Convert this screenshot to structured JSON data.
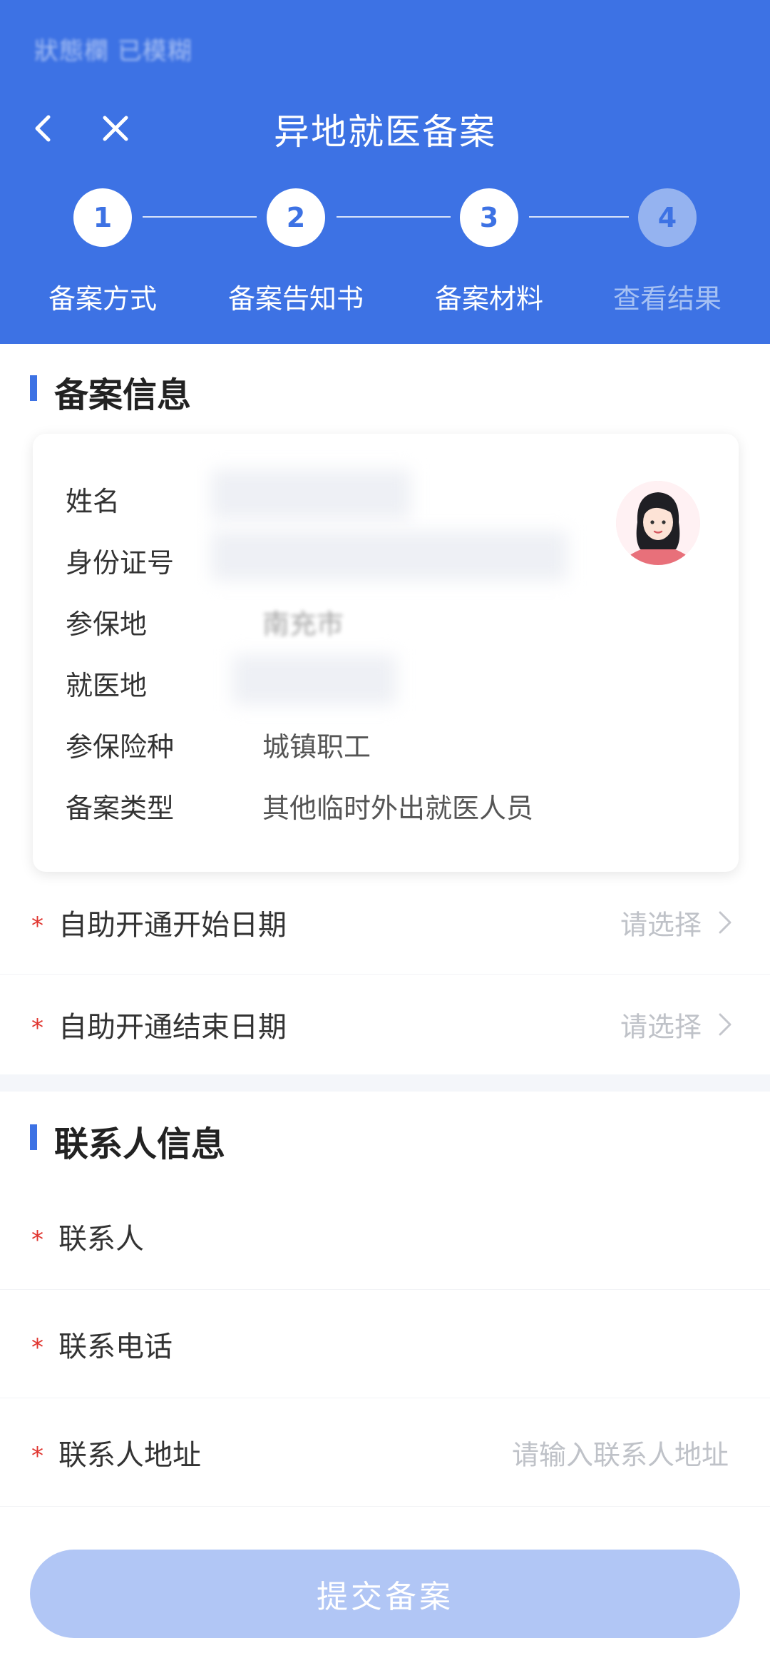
{
  "header": {
    "status_text": "狀態欄 已模糊",
    "title": "异地就医备案",
    "back_icon": "chevron-left-icon",
    "close_icon": "close-icon",
    "color": "#3d72e4"
  },
  "steps": [
    {
      "number": "1",
      "label": "备案方式",
      "state": "done"
    },
    {
      "number": "2",
      "label": "备案告知书",
      "state": "done"
    },
    {
      "number": "3",
      "label": "备案材料",
      "state": "current"
    },
    {
      "number": "4",
      "label": "查看结果",
      "state": "pending"
    }
  ],
  "record_section": {
    "title": "备案信息",
    "fields": [
      {
        "label": "姓名",
        "value": ""
      },
      {
        "label": "身份证号",
        "value": ""
      },
      {
        "label": "参保地",
        "value": "南充市"
      },
      {
        "label": "就医地",
        "value": ""
      },
      {
        "label": "参保险种",
        "value": "城镇职工"
      },
      {
        "label": "备案类型",
        "value": "其他临时外出就医人员"
      }
    ],
    "avatar_icon": "female-avatar-icon",
    "date_rows": [
      {
        "required": "*",
        "label": "自助开通开始日期",
        "placeholder": "请选择"
      },
      {
        "required": "*",
        "label": "自助开通结束日期",
        "placeholder": "请选择"
      }
    ]
  },
  "contact_section": {
    "title": "联系人信息",
    "rows": [
      {
        "required": "*",
        "label": "联系人",
        "placeholder": ""
      },
      {
        "required": "*",
        "label": "联系电话",
        "placeholder": ""
      },
      {
        "required": "*",
        "label": "联系人地址",
        "placeholder": "请输入联系人地址"
      }
    ]
  },
  "submit": {
    "label": "提交备案",
    "enabled": false,
    "color": "#b1c6f5"
  }
}
